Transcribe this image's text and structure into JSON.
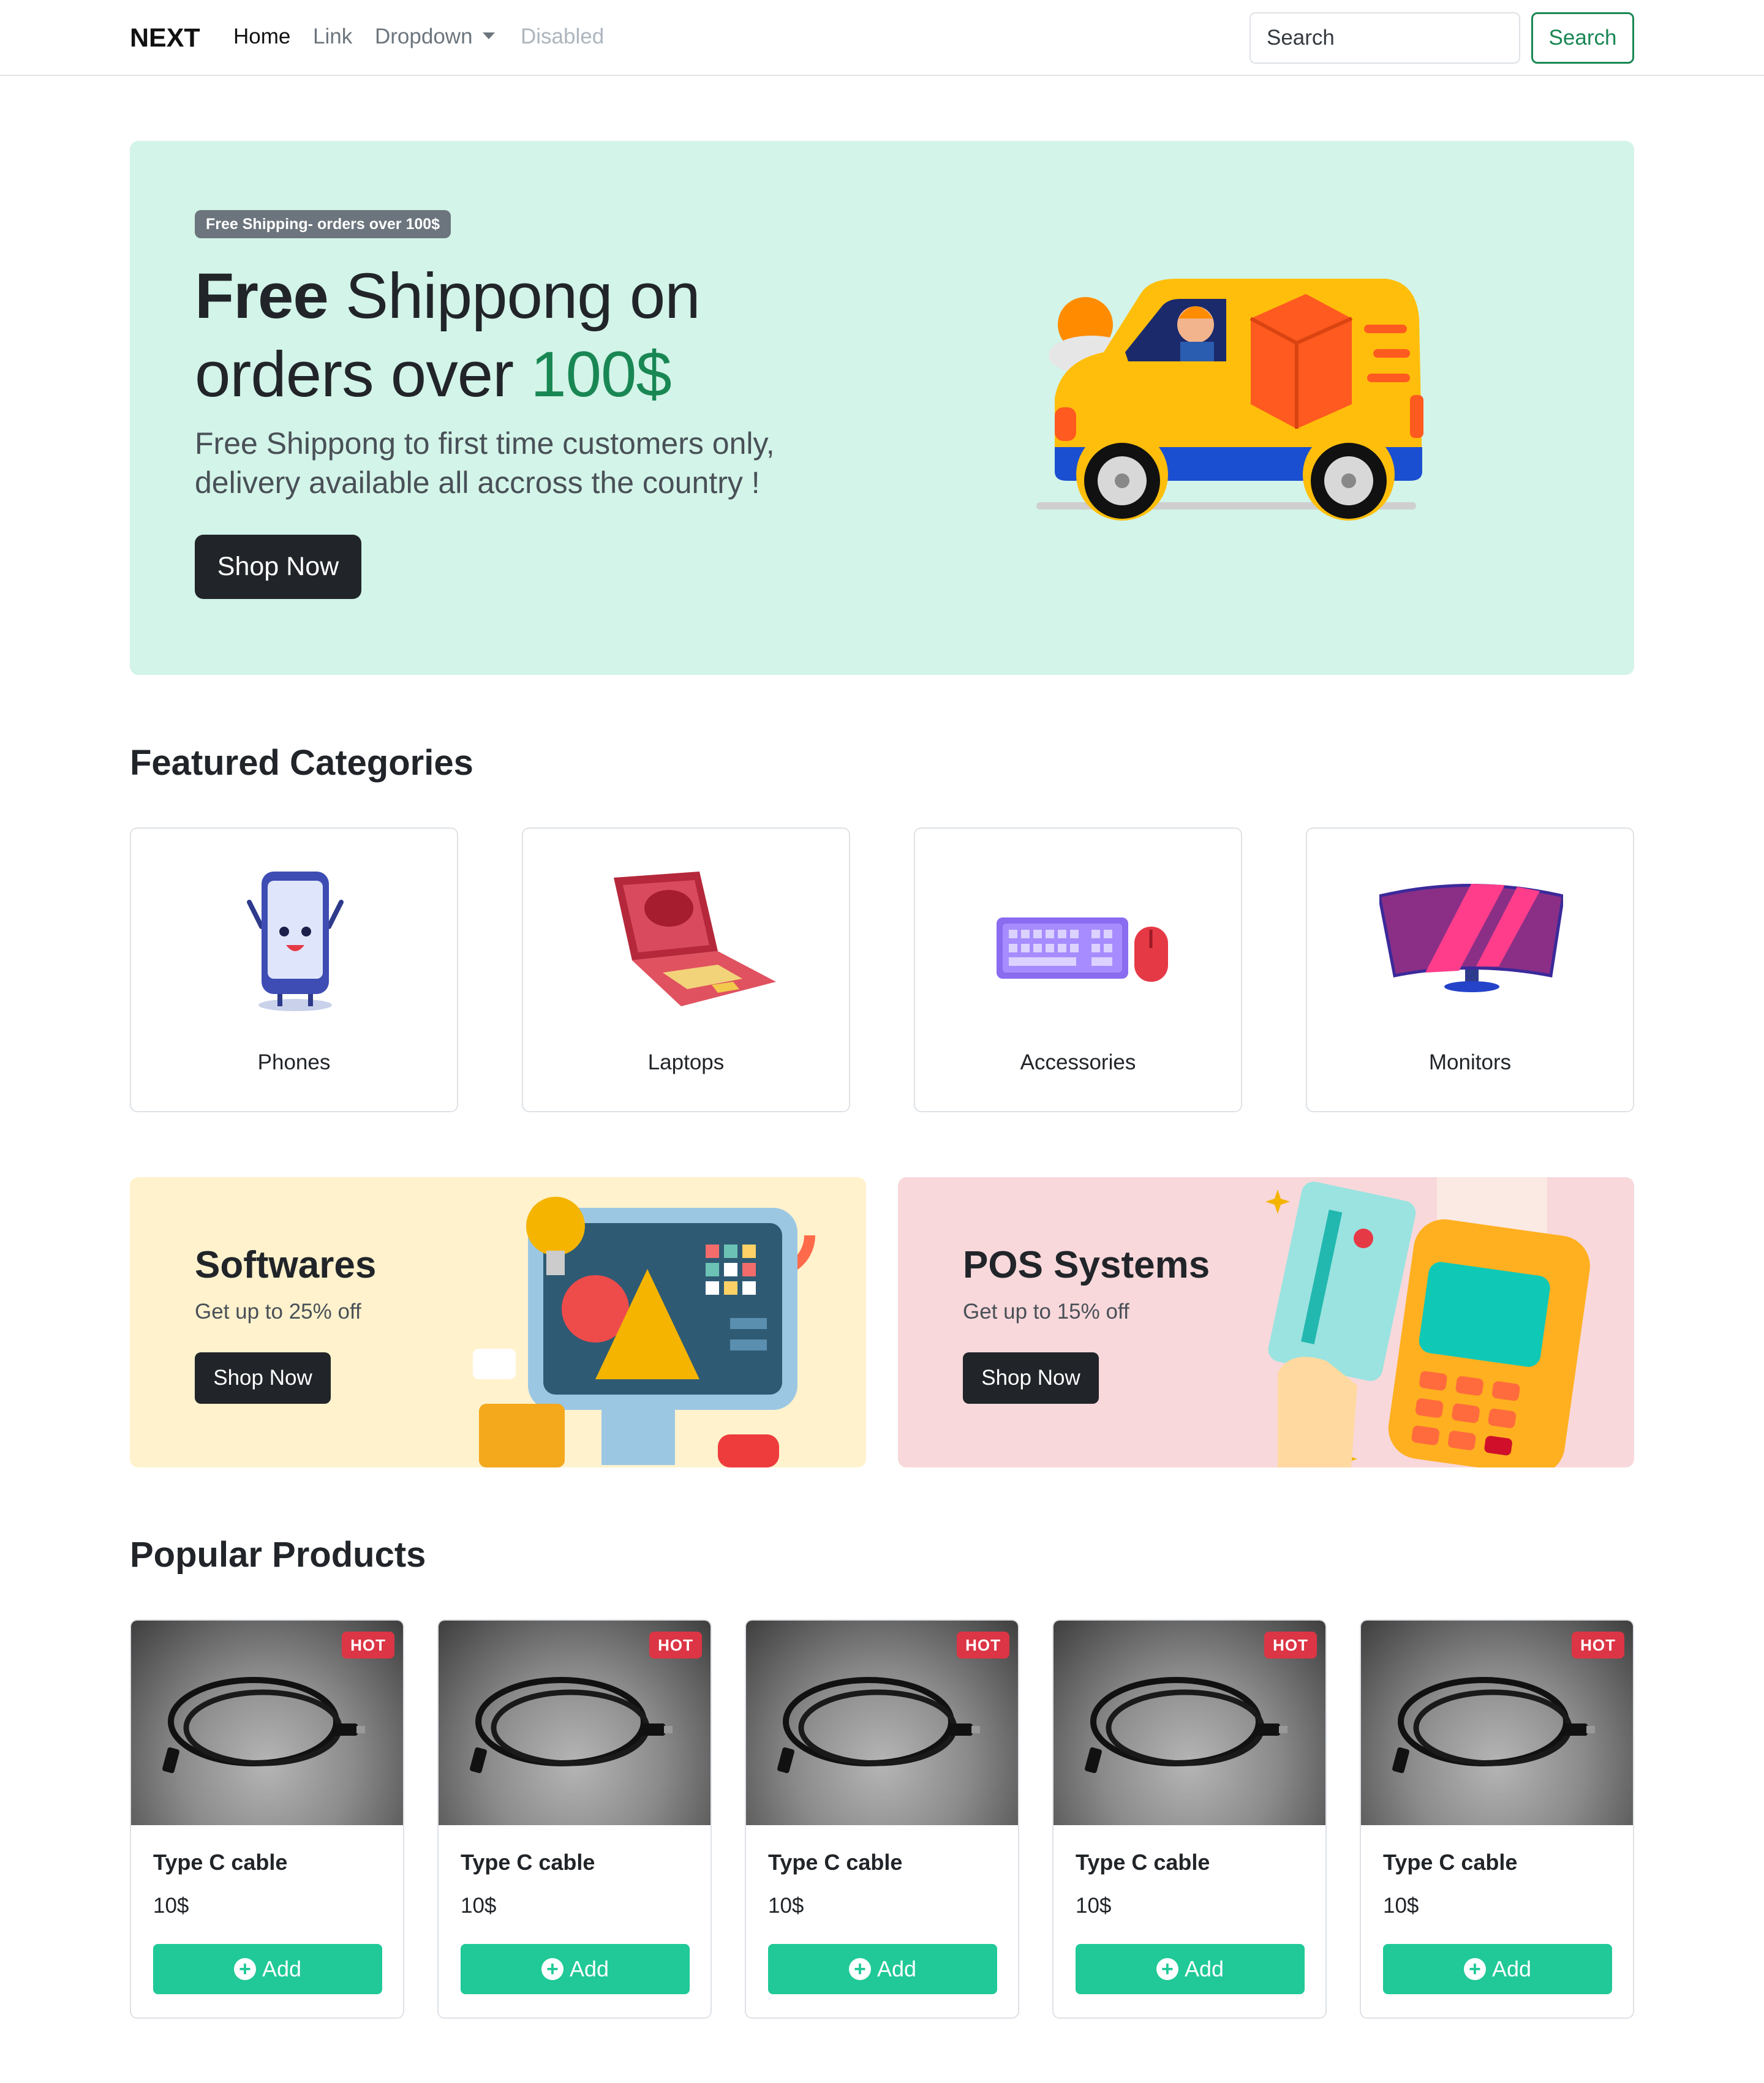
{
  "navbar": {
    "brand": "NEXT",
    "links": [
      {
        "label": "Home",
        "state": "active"
      },
      {
        "label": "Link",
        "state": "normal"
      },
      {
        "label": "Dropdown",
        "state": "dropdown"
      },
      {
        "label": "Disabled",
        "state": "disabled"
      }
    ],
    "search_placeholder": "Search",
    "search_button": "Search"
  },
  "hero": {
    "badge": "Free Shipping- orders over 100$",
    "title_bold": "Free",
    "title_rest_1": " Shippong on",
    "title_rest_2": "orders over ",
    "title_accent": "100$",
    "subtitle": "Free Shippong to first time customers only, delivery available all accross the country !",
    "button": "Shop Now",
    "background": "#d3f4e8",
    "accent_color": "#198754"
  },
  "categories": {
    "title": "Featured Categories",
    "items": [
      {
        "label": "Phones",
        "icon": "phone-icon"
      },
      {
        "label": "Laptops",
        "icon": "laptop-icon"
      },
      {
        "label": "Accessories",
        "icon": "keyboard-mouse-icon"
      },
      {
        "label": "Monitors",
        "icon": "monitor-icon"
      }
    ]
  },
  "promos": [
    {
      "title": "Softwares",
      "subtitle": "Get up to 25% off",
      "button": "Shop Now",
      "background": "#fff2cd"
    },
    {
      "title": "POS Systems",
      "subtitle": "Get up to 15% off",
      "button": "Shop Now",
      "background": "#f8d8db"
    }
  ],
  "products": {
    "title": "Popular Products",
    "items": [
      {
        "name": "Type C cable",
        "price": "10$",
        "badge": "HOT",
        "button": "Add"
      },
      {
        "name": "Type C cable",
        "price": "10$",
        "badge": "HOT",
        "button": "Add"
      },
      {
        "name": "Type C cable",
        "price": "10$",
        "badge": "HOT",
        "button": "Add"
      },
      {
        "name": "Type C cable",
        "price": "10$",
        "badge": "HOT",
        "button": "Add"
      },
      {
        "name": "Type C cable",
        "price": "10$",
        "badge": "HOT",
        "button": "Add"
      }
    ],
    "button_color": "#20c997",
    "badge_color": "#dc3545"
  }
}
